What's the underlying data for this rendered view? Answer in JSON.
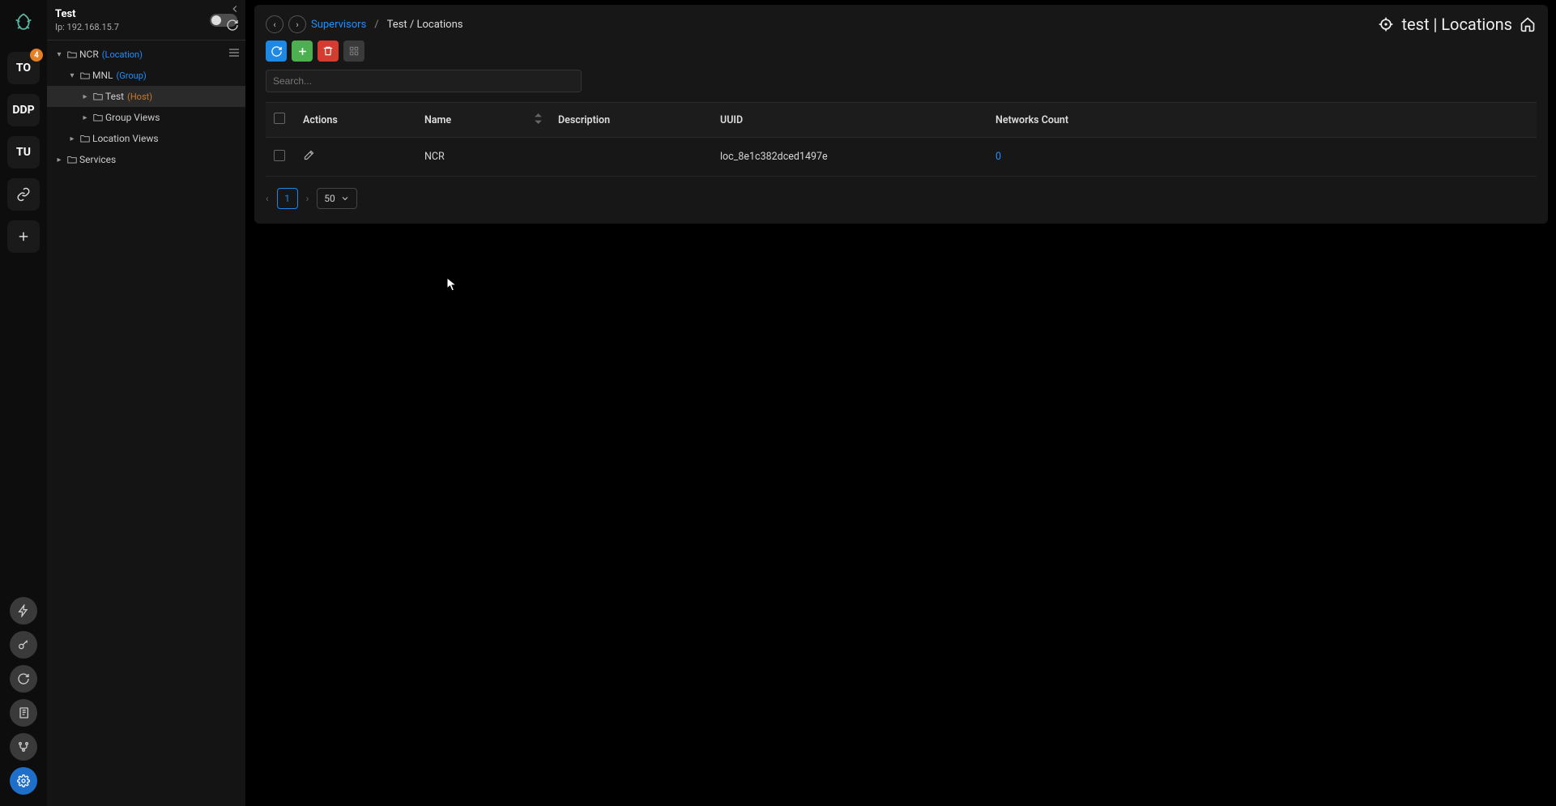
{
  "rail": {
    "items": [
      {
        "label": "TO",
        "badge": 4
      },
      {
        "label": "DDP"
      },
      {
        "label": "TU"
      }
    ],
    "bottom": [
      {
        "name": "lightning-icon"
      },
      {
        "name": "key-icon"
      },
      {
        "name": "sync-icon"
      },
      {
        "name": "notebook-icon"
      },
      {
        "name": "branch-icon"
      },
      {
        "name": "settings-icon",
        "active": true
      }
    ]
  },
  "side": {
    "title": "Test",
    "subtitle": "Ip: 192.168.15.7",
    "tree": [
      {
        "level": 1,
        "expanded": true,
        "label": "NCR",
        "tag": "(Location)",
        "menu": true
      },
      {
        "level": 2,
        "expanded": true,
        "label": "MNL",
        "tag": "(Group)"
      },
      {
        "level": 3,
        "closed": true,
        "label": "Test",
        "tag": "(Host)",
        "tagClass": "orange",
        "selected": true
      },
      {
        "level": 3,
        "leaf": true,
        "label": "Group Views"
      },
      {
        "level": 2,
        "leaf": true,
        "label": "Location Views"
      },
      {
        "level": 1,
        "closed": true,
        "label": "Services"
      }
    ]
  },
  "main": {
    "breadcrumb": {
      "back": "‹",
      "fwd": "›",
      "link": "Supervisors",
      "sep": "/",
      "current": "Test / Locations"
    },
    "title": "test | Locations",
    "search_placeholder": "Search...",
    "columns": {
      "actions": "Actions",
      "name": "Name",
      "description": "Description",
      "uuid": "UUID",
      "networks": "Networks Count"
    },
    "rows": [
      {
        "name": "NCR",
        "description": "",
        "uuid": "loc_8e1c382dced1497e",
        "networks": "0"
      }
    ],
    "pagination": {
      "page": "1",
      "size": "50"
    }
  }
}
